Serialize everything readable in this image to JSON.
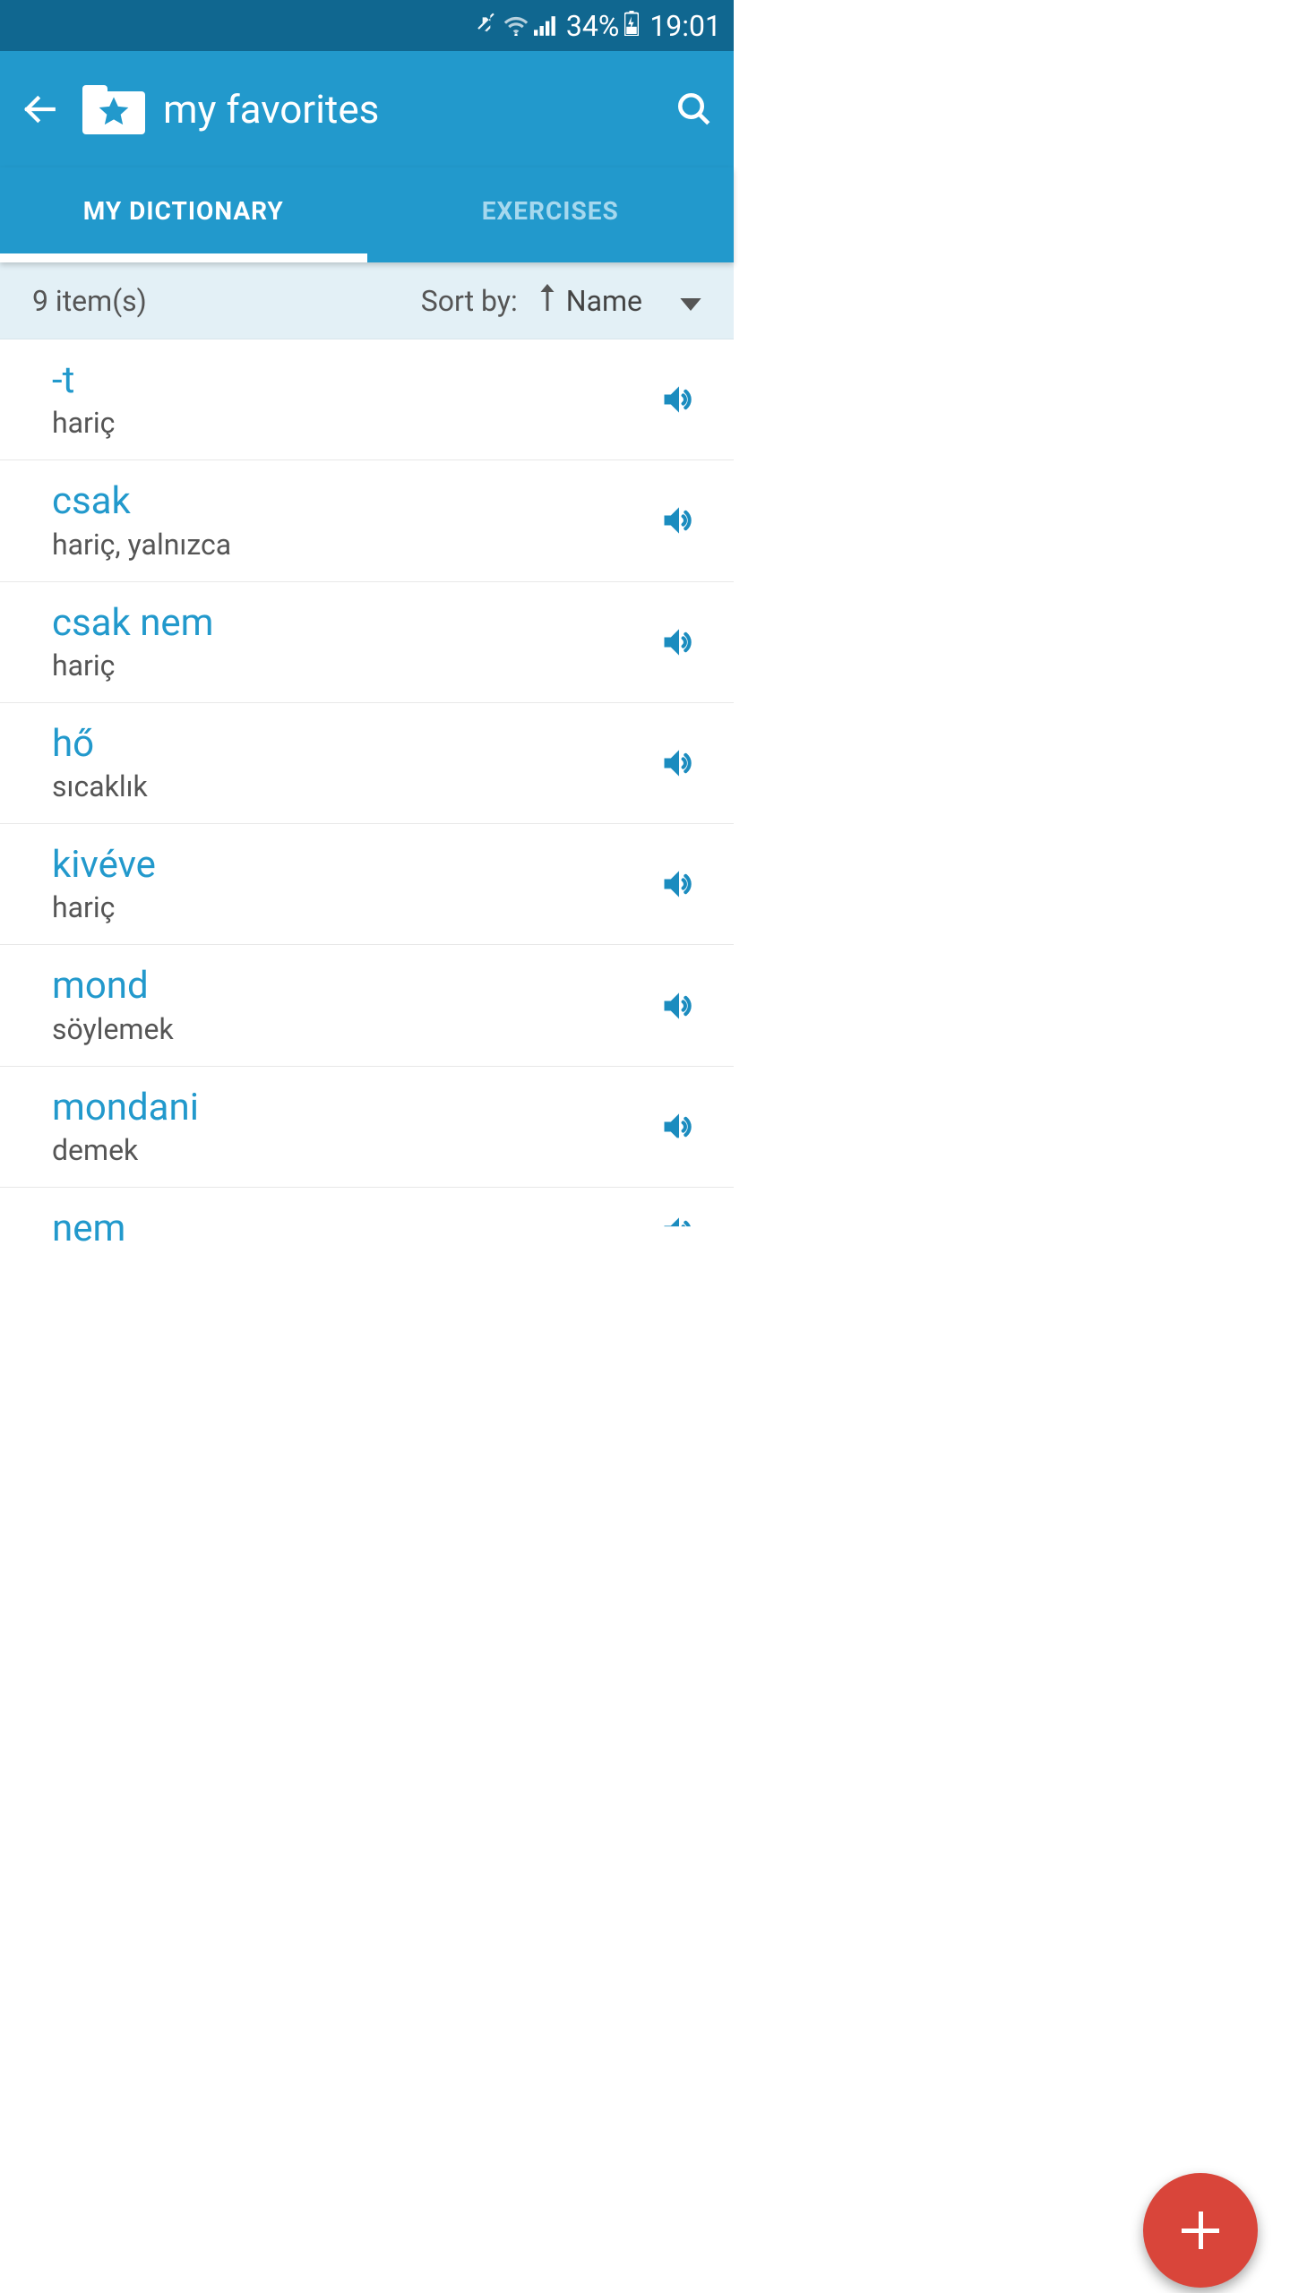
{
  "status": {
    "battery": "34%",
    "time": "19:01"
  },
  "header": {
    "title": "my favorites"
  },
  "tabs": {
    "dictionary": "MY DICTIONARY",
    "exercises": "EXERCISES"
  },
  "sort": {
    "count": "9 item(s)",
    "label": "Sort by:",
    "field": "Name"
  },
  "items": [
    {
      "word": "-t",
      "trans": "hariç"
    },
    {
      "word": "csak",
      "trans": "hariç, yalnızca"
    },
    {
      "word": "csak nem",
      "trans": "hariç"
    },
    {
      "word": "hő",
      "trans": "sıcaklık"
    },
    {
      "word": "kivéve",
      "trans": "hariç"
    },
    {
      "word": "mond",
      "trans": "söylemek"
    },
    {
      "word": "mondani",
      "trans": "demek"
    },
    {
      "word": "nem",
      "trans": ""
    }
  ]
}
